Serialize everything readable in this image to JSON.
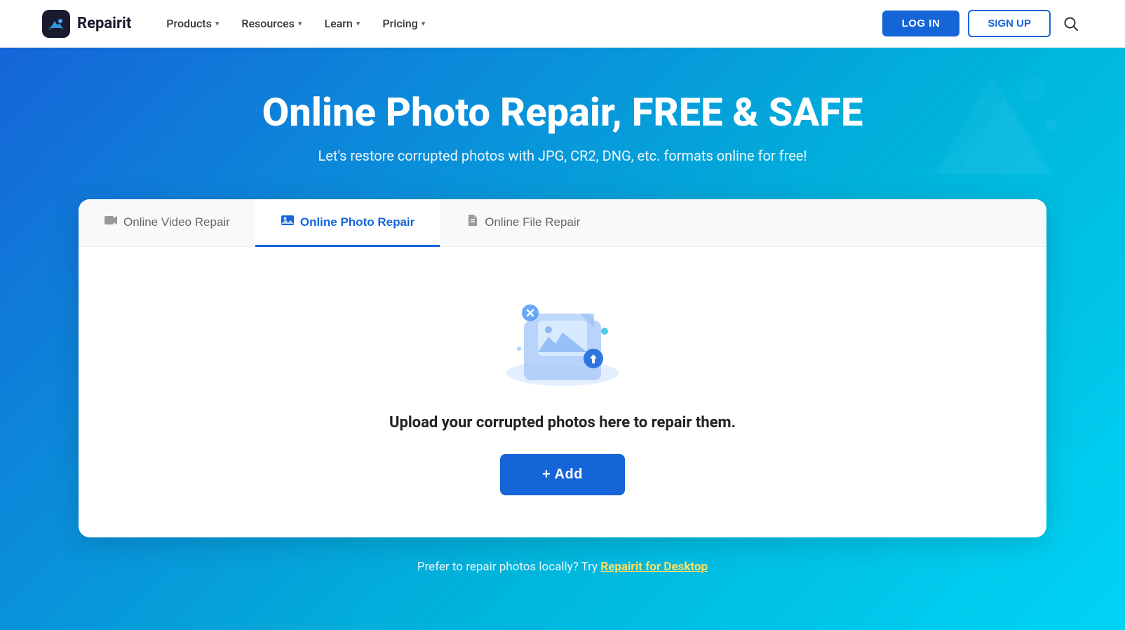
{
  "nav": {
    "logo_text": "Repairit",
    "links": [
      {
        "label": "Products",
        "has_dropdown": true
      },
      {
        "label": "Resources",
        "has_dropdown": true
      },
      {
        "label": "Learn",
        "has_dropdown": true
      },
      {
        "label": "Pricing",
        "has_dropdown": true
      }
    ],
    "login_label": "LOG IN",
    "signup_label": "SIGN UP"
  },
  "hero": {
    "title": "Online Photo Repair, FREE & SAFE",
    "subtitle": "Let's restore corrupted photos with JPG, CR2, DNG, etc. formats online for free!"
  },
  "tabs": [
    {
      "label": "Online Video Repair",
      "icon": "video",
      "active": false
    },
    {
      "label": "Online Photo Repair",
      "icon": "photo",
      "active": true
    },
    {
      "label": "Online File Repair",
      "icon": "file",
      "active": false
    }
  ],
  "upload": {
    "text": "Upload your corrupted photos here to repair them.",
    "add_label": "+ Add"
  },
  "footer_hint": {
    "text": "Prefer to repair photos locally? Try ",
    "link_text": "Repairit for Desktop"
  }
}
